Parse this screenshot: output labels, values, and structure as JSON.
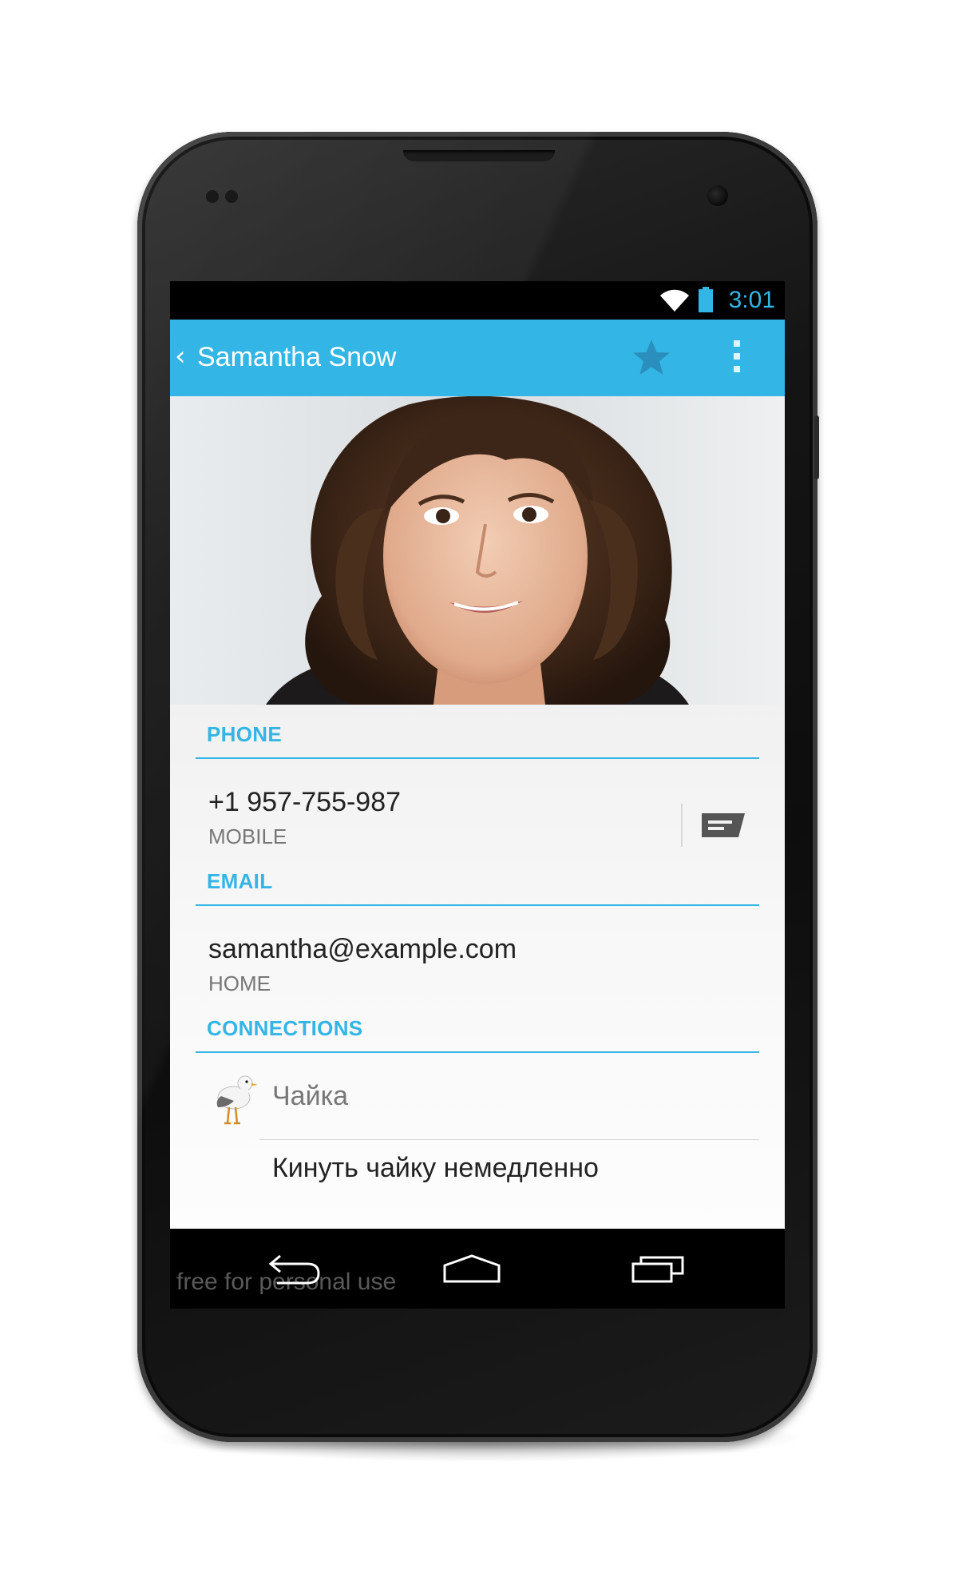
{
  "status_bar": {
    "time": "3:01",
    "icons": [
      "wifi-icon",
      "battery-icon"
    ],
    "accent_color": "#33b5e5"
  },
  "action_bar": {
    "title": "Samantha Snow",
    "icons": [
      "back-chevron-icon",
      "star-icon",
      "overflow-menu-icon"
    ],
    "background_color": "#33b5e5"
  },
  "photo": {
    "description_icon": "contact-photo"
  },
  "phone_section": {
    "header": "PHONE",
    "number": "+1 957-755-987",
    "type": "MOBILE",
    "action_icon": "sms-icon"
  },
  "email_section": {
    "header": "EMAIL",
    "address": "samantha@example.com",
    "type": "HOME"
  },
  "connections_section": {
    "header": "CONNECTIONS",
    "app_icon": "seagull-icon",
    "app_name": "Чайка",
    "action": "Кинуть чайку немедленно"
  },
  "nav_bar": {
    "icons": [
      "back-icon",
      "home-icon",
      "recents-icon"
    ],
    "watermark": "free for personal use"
  }
}
